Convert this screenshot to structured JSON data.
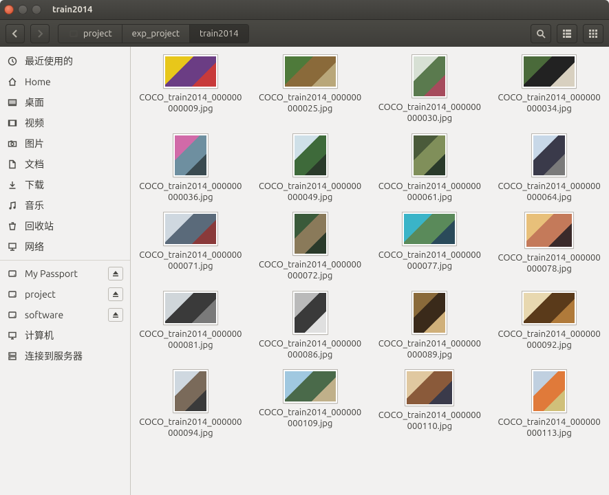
{
  "window": {
    "title": "train2014"
  },
  "toolbar": {
    "breadcrumbs": [
      {
        "icon": "drive",
        "label": "project"
      },
      {
        "label": "exp_project"
      },
      {
        "label": "train2014",
        "active": true
      }
    ]
  },
  "sidebar": {
    "places": [
      {
        "icon": "clock",
        "label": "最近使用的"
      },
      {
        "icon": "home",
        "label": "Home"
      },
      {
        "icon": "desktop",
        "label": "桌面"
      },
      {
        "icon": "video",
        "label": "视频"
      },
      {
        "icon": "camera",
        "label": "图片"
      },
      {
        "icon": "document",
        "label": "文档"
      },
      {
        "icon": "download",
        "label": "下载"
      },
      {
        "icon": "music",
        "label": "音乐"
      },
      {
        "icon": "trash",
        "label": "回收站"
      },
      {
        "icon": "network-folder",
        "label": "网络"
      }
    ],
    "devices": [
      {
        "icon": "drive",
        "label": "My Passport",
        "eject": true
      },
      {
        "icon": "drive",
        "label": "project",
        "eject": true
      },
      {
        "icon": "drive",
        "label": "software",
        "eject": true
      },
      {
        "icon": "computer",
        "label": "计算机",
        "eject": false
      },
      {
        "icon": "server",
        "label": "连接到服务器",
        "eject": false
      }
    ]
  },
  "files": [
    {
      "name": "COCO_train2014_000000000009.jpg",
      "shape": "wide",
      "colors": [
        "#e8c71a",
        "#6b3d84",
        "#c83a3a"
      ]
    },
    {
      "name": "COCO_train2014_000000000025.jpg",
      "shape": "wide",
      "colors": [
        "#4e7a3a",
        "#8a6a3a",
        "#b9a77a"
      ]
    },
    {
      "name": "COCO_train2014_000000000030.jpg",
      "shape": "tall",
      "colors": [
        "#d7e0d4",
        "#5a7a4e",
        "#a64b5c"
      ]
    },
    {
      "name": "COCO_train2014_000000000034.jpg",
      "shape": "wide",
      "colors": [
        "#4a6a3a",
        "#222",
        "#d8d0c0"
      ]
    },
    {
      "name": "COCO_train2014_000000000036.jpg",
      "shape": "tall",
      "colors": [
        "#d16aa8",
        "#6e8fa0",
        "#3a4a50"
      ]
    },
    {
      "name": "COCO_train2014_000000000049.jpg",
      "shape": "tall",
      "colors": [
        "#cfe0e8",
        "#3e6a3a",
        "#2a3a2a"
      ]
    },
    {
      "name": "COCO_train2014_000000000061.jpg",
      "shape": "tall",
      "colors": [
        "#4a5a3a",
        "#808f5a",
        "#2a3a2a"
      ]
    },
    {
      "name": "COCO_train2014_000000000064.jpg",
      "shape": "tall",
      "colors": [
        "#c8d8e8",
        "#3a3a4a",
        "#7a7a7a"
      ]
    },
    {
      "name": "COCO_train2014_000000000071.jpg",
      "shape": "wide",
      "colors": [
        "#cfd8e0",
        "#5a6a7a",
        "#8a3a3a"
      ]
    },
    {
      "name": "COCO_train2014_000000000072.jpg",
      "shape": "tall",
      "colors": [
        "#3a5a3a",
        "#8a7a5a",
        "#2a3a2a"
      ]
    },
    {
      "name": "COCO_train2014_000000000077.jpg",
      "shape": "wide",
      "colors": [
        "#3ab4c8",
        "#5a8a5a",
        "#2a4a5a"
      ]
    },
    {
      "name": "COCO_train2014_000000000078.jpg",
      "shape": "norm",
      "colors": [
        "#e8c07a",
        "#c47a5a",
        "#3a2a2a"
      ]
    },
    {
      "name": "COCO_train2014_000000000081.jpg",
      "shape": "wide",
      "colors": [
        "#d0d6da",
        "#3a3a3a",
        "#7a7a7a"
      ]
    },
    {
      "name": "COCO_train2014_000000000086.jpg",
      "shape": "tall",
      "colors": [
        "#bababa",
        "#3a3a3a",
        "#e0e0e0"
      ]
    },
    {
      "name": "COCO_train2014_000000000089.jpg",
      "shape": "tall",
      "colors": [
        "#8a6a3a",
        "#3a2a1a",
        "#d0b07a"
      ]
    },
    {
      "name": "COCO_train2014_000000000092.jpg",
      "shape": "wide",
      "colors": [
        "#e8d8b0",
        "#5a3a1a",
        "#b07a3a"
      ]
    },
    {
      "name": "COCO_train2014_000000000094.jpg",
      "shape": "tall",
      "colors": [
        "#cfd8e0",
        "#7a6a5a",
        "#3a3a3a"
      ]
    },
    {
      "name": "COCO_train2014_000000000109.jpg",
      "shape": "wide",
      "colors": [
        "#a0c8e0",
        "#4a6a4a",
        "#c0b08a"
      ]
    },
    {
      "name": "COCO_train2014_000000000110.jpg",
      "shape": "norm",
      "colors": [
        "#e0c8a0",
        "#8a5a3a",
        "#3a3a4a"
      ]
    },
    {
      "name": "COCO_train2014_000000000113.jpg",
      "shape": "tall",
      "colors": [
        "#c0d0e0",
        "#e07a3a",
        "#d0c07a"
      ]
    }
  ]
}
